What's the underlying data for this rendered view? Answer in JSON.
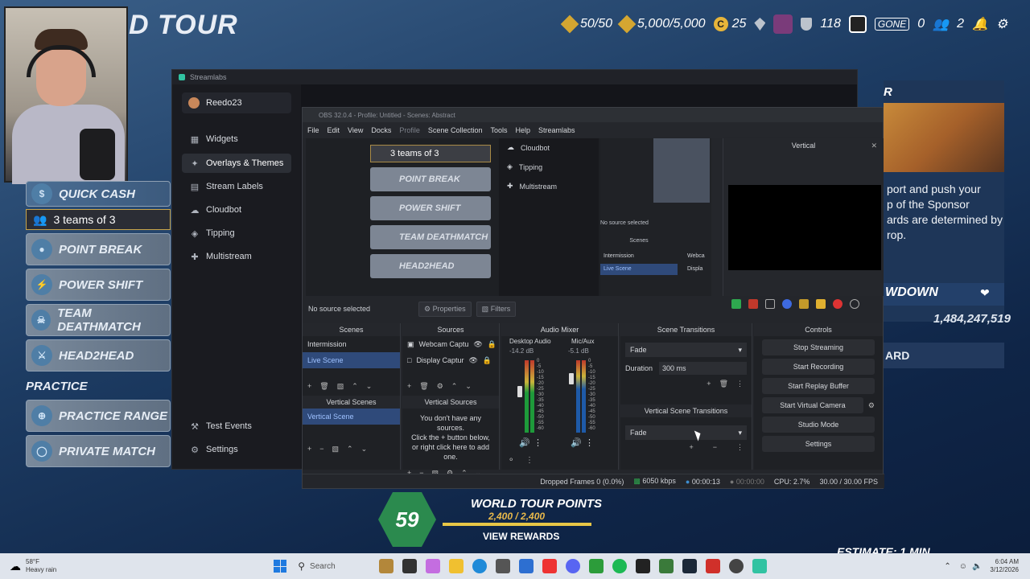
{
  "game": {
    "title_fragment": "D TOUR",
    "topbar": {
      "credits": "50/50",
      "gold": "5,000/5,000",
      "coins": "25",
      "level": "118",
      "gone_label": "GONE",
      "gone_count": "0",
      "party": "2"
    },
    "menu": {
      "quick_cash": "QUICK CASH",
      "teams": "3 teams of 3",
      "point_break": "POINT BREAK",
      "power_shift": "POWER SHIFT",
      "team_deathmatch": "TEAM DEATHMATCH",
      "head2head": "HEAD2HEAD",
      "practice_header": "PRACTICE",
      "practice_range": "PRACTICE RANGE",
      "private_match": "PRIVATE MATCH"
    },
    "right": {
      "header_fragment": "R",
      "text": "port and push your\np of the Sponsor\nards are determined by\nrop.",
      "countdown_label": "WDOWN",
      "score": "1,484,247,519",
      "board_label": "ARD",
      "estimate": "ESTIMATE: 1 MIN"
    },
    "world_tour": {
      "level": "59",
      "title": "WORLD TOUR POINTS",
      "points": "2,400 / 2,400",
      "progress": 1.0,
      "rewards": "VIEW REWARDS"
    }
  },
  "streamlabs": {
    "title": "Streamlabs",
    "user": "Reedo23",
    "nav": [
      "Widgets",
      "Overlays & Themes",
      "Stream Labels",
      "Cloudbot",
      "Tipping",
      "Multistream"
    ],
    "bottom": [
      "Test Events",
      "Settings"
    ]
  },
  "obs": {
    "title": "OBS 32.0.4 - Profile: Untitled - Scenes: Abstract",
    "menu": [
      "File",
      "Edit",
      "View",
      "Docks",
      "Profile",
      "Scene Collection",
      "Tools",
      "Help",
      "Streamlabs"
    ],
    "preview_side": [
      "Cloudbot",
      "Tipping",
      "Multistream"
    ],
    "preview_teams": "3 teams of 3",
    "preview_items": [
      "POINT BREAK",
      "POWER SHIFT",
      "TEAM DEATHMATCH",
      "HEAD2HEAD"
    ],
    "mini_scenes": [
      "Intermission",
      "Live Scene"
    ],
    "mini_sources": [
      "Webca",
      "Displa"
    ],
    "mini_status": "No source selected",
    "mini_scenes_label": "Scenes",
    "vertical_title": "Vertical",
    "no_source": "No source selected",
    "properties": "Properties",
    "filters": "Filters",
    "docks": {
      "scenes": "Scenes",
      "sources": "Sources",
      "audio_mixer": "Audio Mixer",
      "scene_transitions": "Scene Transitions",
      "controls": "Controls",
      "vertical_scenes": "Vertical Scenes",
      "vertical_sources": "Vertical Sources",
      "vertical_transitions": "Vertical Scene Transitions"
    },
    "scenes": [
      "Intermission",
      "Live Scene"
    ],
    "sources": [
      "Webcam Captu",
      "Display Captur"
    ],
    "audio": [
      {
        "name": "Desktop Audio",
        "db": "-14.2 dB"
      },
      {
        "name": "Mic/Aux",
        "db": "-5.1 dB"
      }
    ],
    "meter_ticks": [
      "0",
      "-5",
      "-10",
      "-15",
      "-20",
      "-25",
      "-30",
      "-35",
      "-40",
      "-45",
      "-50",
      "-55",
      "-60"
    ],
    "transition": "Fade",
    "duration_label": "Duration",
    "duration_value": "300 ms",
    "vertical_transition": "Fade",
    "vertical_scene": "Vertical Scene",
    "vertical_sources_empty": "You don't have any sources.\nClick the + button below,\nor right click here to add one.",
    "controls": [
      "Stop Streaming",
      "Start Recording",
      "Start Replay Buffer",
      "Start Virtual Camera",
      "Studio Mode",
      "Settings"
    ],
    "status": {
      "dropped": "Dropped Frames 0 (0.0%)",
      "kbps": "6050 kbps",
      "stream_time": "00:00:13",
      "rec_time": "00:00:00",
      "cpu": "CPU: 2.7%",
      "fps": "30.00 / 30.00 FPS"
    }
  },
  "taskbar": {
    "weather_temp": "58°F",
    "weather_desc": "Heavy rain",
    "search": "Search",
    "time": "6:04 AM",
    "date": "3/12/2026"
  }
}
